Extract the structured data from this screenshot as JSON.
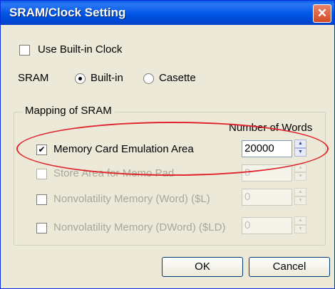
{
  "window": {
    "title": "SRAM/Clock Setting",
    "close_glyph": "✕"
  },
  "clock": {
    "label": "Use Built-in Clock",
    "checked": false
  },
  "sram": {
    "label": "SRAM",
    "options": [
      {
        "label": "Built-in",
        "selected": true
      },
      {
        "label": "Casette",
        "selected": false
      }
    ]
  },
  "mapping": {
    "group_title": "Mapping of SRAM",
    "column_header": "Number of Words",
    "rows": [
      {
        "label": "Memory Card Emulation Area",
        "checked": true,
        "value": "20000",
        "enabled": true
      },
      {
        "label": "Store Area for Memo Pad",
        "checked": false,
        "value": "0",
        "enabled": false
      },
      {
        "label": "Nonvolatility Memory (Word) ($L)",
        "checked": false,
        "value": "0",
        "enabled": false
      },
      {
        "label": "Nonvolatility Memory (DWord) ($LD)",
        "checked": false,
        "value": "0",
        "enabled": false
      }
    ]
  },
  "buttons": {
    "ok": "OK",
    "cancel": "Cancel"
  },
  "colors": {
    "highlight_ellipse": "#e0242c",
    "titlebar": "#0055e5"
  }
}
